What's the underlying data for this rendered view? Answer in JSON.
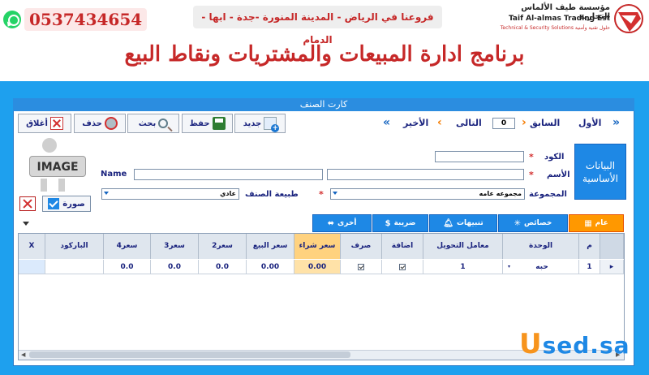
{
  "banner": {
    "phone": "0537434654",
    "branches": "فروعنا في الرياض - المدينة المنورة -جدة - ابها - الدمام",
    "company_ar": "مؤسسة طيف الألماس التجارية",
    "company_en": "Taif Al-almas Trading Est",
    "company_tagline": "Technical & Security Solutions حلول تقنية وأمنية",
    "headline": "برنامج ادارة المبيعات والمشتريات ونقاط البيع",
    "whatsapp_icon": "whatsapp-icon",
    "logo_icon": "company-logo"
  },
  "window": {
    "title": "كارت الصنف"
  },
  "toolbar": {
    "close_label": "أغلاق",
    "delete_label": "حذف",
    "search_label": "بحث",
    "save_label": "حفظ",
    "new_label": "جديد"
  },
  "navigation": {
    "first_label": "الأول",
    "prev_label": "السابق",
    "record_number": "0",
    "next_label": "التالى",
    "last_label": "الأخير"
  },
  "basic_data": {
    "section_label": "البيانات الأساسية",
    "code_label": "الكود",
    "code_value": "",
    "name_label": "الأسم",
    "name_value": "",
    "name_en_label": "Name",
    "name_en_value": "",
    "group_label": "المجموعة",
    "group_value": "مجموعه عامه",
    "item_type_label": "طبيعة الصنف",
    "item_type_value": "عادي",
    "image_placeholder": "IMAGE",
    "photo_label": "صورة"
  },
  "tabs": [
    {
      "label": "عام",
      "active": true,
      "icon": "grid-icon"
    },
    {
      "label": "خصائص",
      "active": false,
      "icon": "sparkle-icon"
    },
    {
      "label": "تنبيهات",
      "active": false,
      "icon": "bell-icon"
    },
    {
      "label": "ضريبة",
      "active": false,
      "icon": "dollar-icon"
    },
    {
      "label": "أخرى",
      "active": false,
      "icon": "other-icon"
    }
  ],
  "grid": {
    "headers": {
      "index": "م",
      "unit": "الوحدة",
      "conversion": "معامل التحويل",
      "add": "اضافة",
      "issue": "صرف",
      "buy_price": "سعر شراء",
      "sell_price": "سعر البيع",
      "price2": "سعر2",
      "price3": "سعر3",
      "price4": "سعر4",
      "barcode": "الباركود",
      "delete": "X"
    },
    "rows": [
      {
        "index": "1",
        "unit": "حبه",
        "conversion": "1",
        "add": true,
        "issue": true,
        "buy_price": "0.00",
        "sell_price": "0.00",
        "price2": "0.0",
        "price3": "0.0",
        "price4": "0.0",
        "barcode": "",
        "delete": ""
      }
    ]
  },
  "watermark": {
    "u": "U",
    "rest": "sed.sa"
  },
  "colors": {
    "frame_blue": "#1ea0ee",
    "tab_blue": "#1e88e5",
    "tab_active": "#ff9800",
    "brand_red": "#c62828",
    "buy_column": "#ffd27f"
  }
}
